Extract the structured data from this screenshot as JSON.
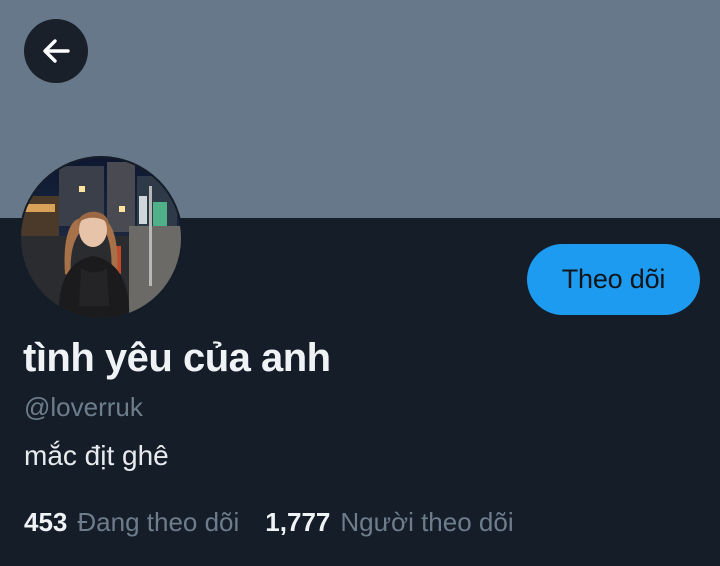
{
  "header": {
    "back_icon": "arrow-left-icon",
    "banner_color": "#66788a"
  },
  "profile": {
    "avatar_icon": "profile-photo",
    "display_name": "tình yêu của anh",
    "handle": "@loverruk",
    "bio": "mắc địt ghê",
    "follow_label": "Theo dõi"
  },
  "stats": {
    "following_count": "453",
    "following_label": "Đang theo dõi",
    "followers_count": "1,777",
    "followers_label": "Người theo dõi"
  },
  "colors": {
    "background": "#151d28",
    "accent": "#1d9bf0",
    "secondary_text": "#6e7d8c"
  }
}
